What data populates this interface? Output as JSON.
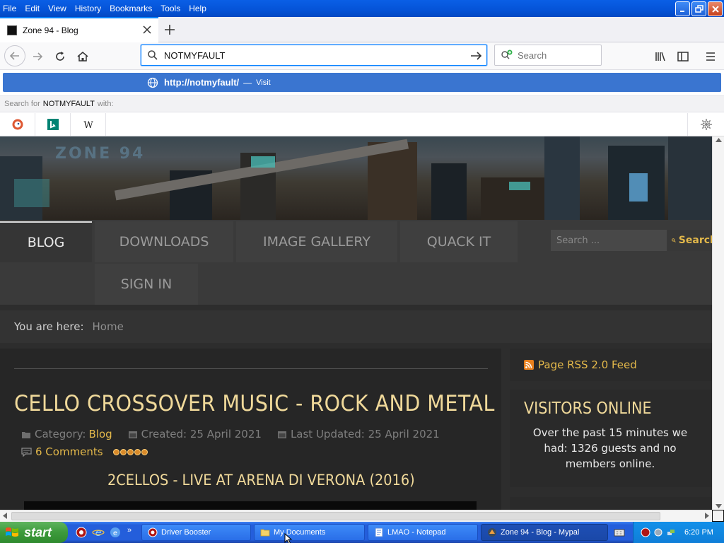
{
  "menubar": {
    "items": [
      "File",
      "Edit",
      "View",
      "History",
      "Bookmarks",
      "Tools",
      "Help"
    ],
    "window_controls": [
      "minimize-icon",
      "restore-icon",
      "close-icon"
    ]
  },
  "tab": {
    "title": "Zone 94 - Blog",
    "close_icon": "close-icon"
  },
  "newtab_icon": "plus-icon",
  "navbar": {
    "back_icon": "back-arrow-icon",
    "forward_icon": "forward-arrow-icon",
    "reload_icon": "reload-icon",
    "home_icon": "home-icon",
    "url_value": "NOTMYFAULT",
    "search_placeholder": "Search",
    "library_icon": "library-icon",
    "sidebar_icon": "sidebar-icon",
    "menu_icon": "hamburger-menu-icon"
  },
  "url_popup": {
    "suggestion_url": "http://notmyfault/",
    "suggestion_sep": "—",
    "suggestion_action": "Visit",
    "search_for_prefix": "Search for",
    "search_for_query": "NOTMYFAULT",
    "search_for_suffix": "with:",
    "engines": [
      "duckduckgo-icon",
      "bing-icon",
      "wikipedia-icon"
    ],
    "settings_icon": "gear-icon"
  },
  "site": {
    "nav": {
      "blog": "BLOG",
      "downloads": "DOWNLOADS",
      "gallery": "IMAGE GALLERY",
      "quack": "QUACK IT",
      "signin": "SIGN IN",
      "search_placeholder": "Search ...",
      "search_button": "Search"
    },
    "breadcrumb": {
      "label": "You are here:",
      "home": "Home"
    },
    "article": {
      "title": "CELLO CROSSOVER MUSIC - ROCK AND METAL",
      "category_label": "Category:",
      "category": "Blog",
      "created": "Created: 25 April 2021",
      "updated": "Last Updated: 25 April 2021",
      "comments": "6 Comments",
      "rating": 5,
      "subtitle": "2CELLOS - LIVE AT ARENA DI VERONA (2016)"
    },
    "sidebar": {
      "rss": "Page RSS 2.0 Feed",
      "visitors_title": "VISITORS ONLINE",
      "visitors_text": "Over the past 15 minutes we had: 1326 guests and no members online."
    }
  },
  "taskbar": {
    "start": "start",
    "tasks": [
      "Driver Booster",
      "My Documents",
      "LMAO - Notepad",
      "Zone 94 - Blog - Mypal"
    ],
    "clock": "6:20 PM"
  },
  "colors": {
    "accent_link": "#e3b84a",
    "heading": "#f0d99a",
    "xp_blue": "#245edb",
    "url_suggestion": "#3a75d0"
  }
}
